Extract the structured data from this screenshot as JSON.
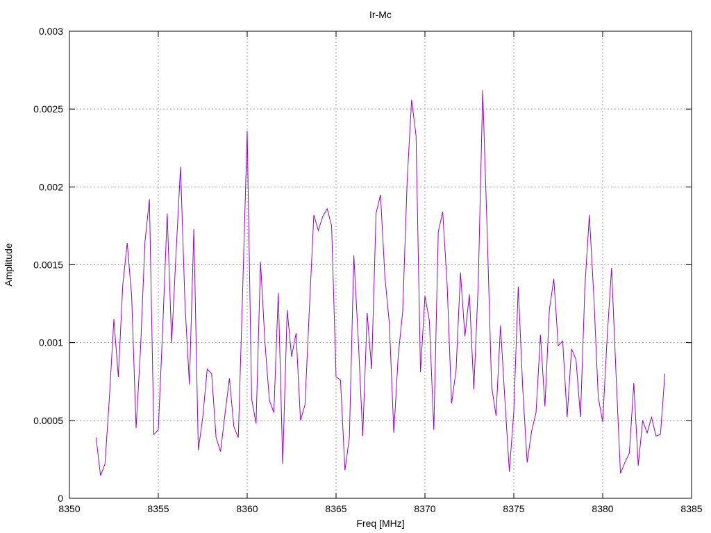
{
  "chart_data": {
    "type": "line",
    "title": "Ir-Mc",
    "xlabel": "Freq [MHz]",
    "ylabel": "Amplitude",
    "xlim": [
      8350,
      8385
    ],
    "ylim": [
      0,
      0.003
    ],
    "xticks": [
      8350,
      8355,
      8360,
      8365,
      8370,
      8375,
      8380,
      8385
    ],
    "xtick_labels": [
      "8350",
      "8355",
      "8360",
      "8365",
      "8370",
      "8375",
      "8380",
      "8385"
    ],
    "yticks": [
      0,
      0.0005,
      0.001,
      0.0015,
      0.002,
      0.0025,
      0.003
    ],
    "ytick_labels": [
      "0",
      "0.0005",
      "0.001",
      "0.0015",
      "0.002",
      "0.0025",
      "0.003"
    ],
    "grid": true,
    "color": "#9400d3",
    "series": [
      {
        "x": [
          8351.5,
          8351.75,
          8352.0,
          8352.25,
          8352.5,
          8352.75,
          8353.0,
          8353.25,
          8353.5,
          8353.75,
          8354.0,
          8354.25,
          8354.5,
          8354.75,
          8355.0,
          8355.25,
          8355.5,
          8355.75,
          8356.0,
          8356.25,
          8356.5,
          8356.75,
          8357.0,
          8357.25,
          8357.5,
          8357.75,
          8358.0,
          8358.25,
          8358.5,
          8358.75,
          8359.0,
          8359.25,
          8359.5,
          8359.75,
          8360.0,
          8360.25,
          8360.5,
          8360.75,
          8361.0,
          8361.25,
          8361.5,
          8361.75,
          8362.0,
          8362.25,
          8362.5,
          8362.75,
          8363.0,
          8363.25,
          8363.5,
          8363.75,
          8364.0,
          8364.25,
          8364.5,
          8364.75,
          8365.0,
          8365.25,
          8365.5,
          8365.75,
          8366.0,
          8366.25,
          8366.5,
          8366.75,
          8367.0,
          8367.25,
          8367.5,
          8367.75,
          8368.0,
          8368.25,
          8368.5,
          8368.75,
          8369.0,
          8369.25,
          8369.5,
          8369.75,
          8370.0,
          8370.25,
          8370.5,
          8370.75,
          8371.0,
          8371.25,
          8371.5,
          8371.75,
          8372.0,
          8372.25,
          8372.5,
          8372.75,
          8373.0,
          8373.25,
          8373.5,
          8373.75,
          8374.0,
          8374.25,
          8374.5,
          8374.75,
          8375.0,
          8375.25,
          8375.5,
          8375.75,
          8376.0,
          8376.25,
          8376.5,
          8376.75,
          8377.0,
          8377.25,
          8377.5,
          8377.75,
          8378.0,
          8378.25,
          8378.5,
          8378.75,
          8379.0,
          8379.25,
          8379.5,
          8379.75,
          8380.0,
          8380.25,
          8380.5,
          8380.75,
          8381.0,
          8381.25,
          8381.5,
          8381.75,
          8382.0,
          8382.25,
          8382.5,
          8382.75,
          8383.0,
          8383.25,
          8383.5
        ],
        "y": [
          0.00039,
          0.000145,
          0.00022,
          0.00065,
          0.00115,
          0.00078,
          0.00137,
          0.00164,
          0.0013,
          0.00045,
          0.00096,
          0.00165,
          0.00192,
          0.00041,
          0.00044,
          0.0011,
          0.00183,
          0.001,
          0.00158,
          0.00213,
          0.00125,
          0.00073,
          0.00173,
          0.00031,
          0.00052,
          0.00083,
          0.0008,
          0.00039,
          0.0003,
          0.00054,
          0.00077,
          0.00046,
          0.00039,
          0.00135,
          0.00236,
          0.00064,
          0.00048,
          0.00152,
          0.001,
          0.00063,
          0.00055,
          0.00132,
          0.00022,
          0.00121,
          0.00091,
          0.00106,
          0.0005,
          0.0006,
          0.00122,
          0.00182,
          0.00172,
          0.00181,
          0.00186,
          0.00175,
          0.00078,
          0.00076,
          0.00018,
          0.00039,
          0.00156,
          0.00102,
          0.0004,
          0.00119,
          0.00083,
          0.00183,
          0.00195,
          0.00142,
          0.00112,
          0.00042,
          0.00092,
          0.0012,
          0.00204,
          0.00256,
          0.00233,
          0.00081,
          0.0013,
          0.00114,
          0.00044,
          0.00171,
          0.00184,
          0.00137,
          0.00061,
          0.00082,
          0.00145,
          0.00104,
          0.00131,
          0.0007,
          0.00138,
          0.00262,
          0.00172,
          0.00072,
          0.00053,
          0.00111,
          0.00063,
          0.00017,
          0.00056,
          0.00136,
          0.00071,
          0.00023,
          0.00043,
          0.00055,
          0.00105,
          0.00059,
          0.00121,
          0.00141,
          0.00098,
          0.00101,
          0.00052,
          0.00096,
          0.00089,
          0.00052,
          0.00136,
          0.00182,
          0.0013,
          0.00065,
          0.00049,
          0.00103,
          0.00148,
          0.0008,
          0.00016,
          0.00023,
          0.00029,
          0.00074,
          0.00021,
          0.0005,
          0.00042,
          0.00052,
          0.0004,
          0.00041,
          0.0008
        ]
      }
    ]
  }
}
